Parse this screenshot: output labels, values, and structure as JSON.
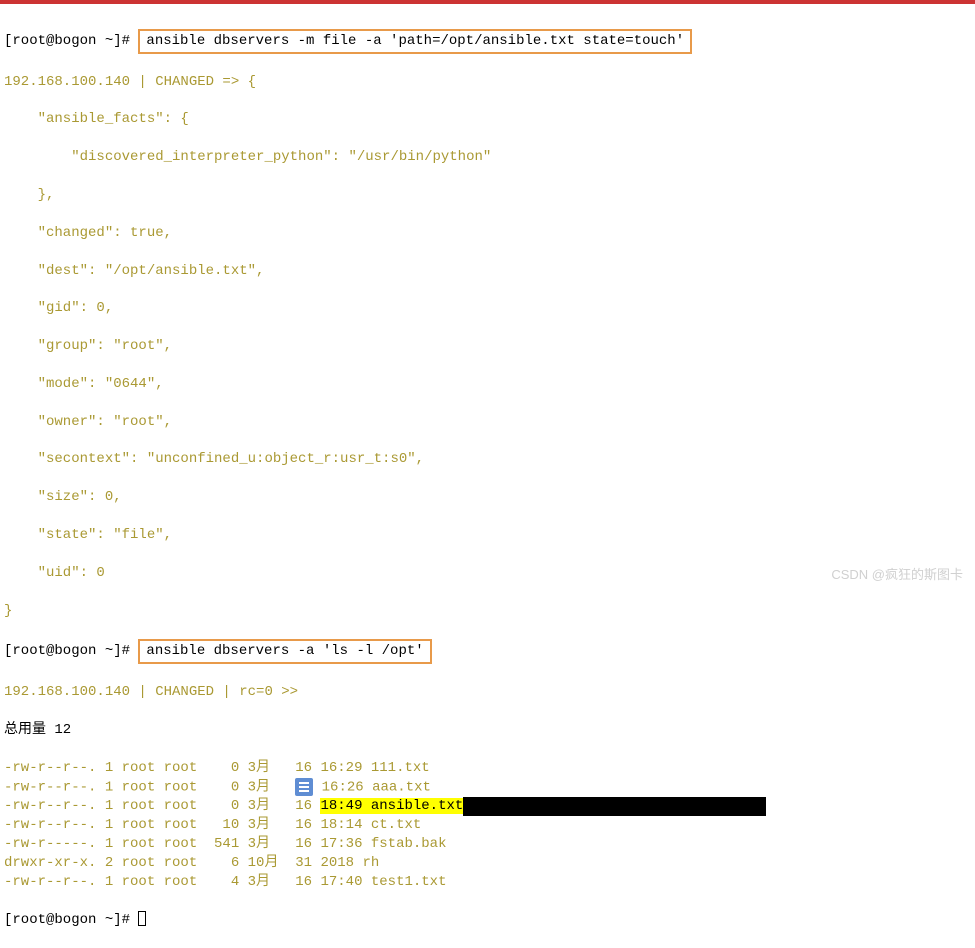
{
  "prompt1": {
    "user": "[root@bogon ~]# ",
    "cmd": "ansible dbservers -m file -a 'path=/opt/ansible.txt state=touch'"
  },
  "output1": {
    "line1": "192.168.100.140 | CHANGED => {",
    "line2": "    \"ansible_facts\": {",
    "line3": "        \"discovered_interpreter_python\": \"/usr/bin/python\"",
    "line4": "    },",
    "line5": "    \"changed\": true,",
    "line6": "    \"dest\": \"/opt/ansible.txt\",",
    "line7": "    \"gid\": 0,",
    "line8": "    \"group\": \"root\",",
    "line9": "    \"mode\": \"0644\",",
    "line10": "    \"owner\": \"root\",",
    "line11": "    \"secontext\": \"unconfined_u:object_r:usr_t:s0\",",
    "line12": "    \"size\": 0,",
    "line13": "    \"state\": \"file\",",
    "line14": "    \"uid\": 0",
    "line15": "}"
  },
  "prompt2": {
    "user": "[root@bogon ~]# ",
    "cmd": "ansible dbservers -a 'ls -l /opt'"
  },
  "output2": {
    "header": "192.168.100.140 | CHANGED | rc=0 >>",
    "total": "总用量 12",
    "files": [
      {
        "perm": "-rw-r--r--. 1 root root",
        "sz": "   0",
        "mon": "3月",
        "d": "16",
        "tm": "16:29",
        "n": "111.txt",
        "hl": false,
        "icon": false
      },
      {
        "perm": "-rw-r--r--. 1 root root",
        "sz": "   0",
        "mon": "3月",
        "d": "",
        "tm": "16:26",
        "n": "aaa.txt",
        "hl": false,
        "icon": true
      },
      {
        "perm": "-rw-r--r--. 1 root root",
        "sz": "   0",
        "mon": "3月",
        "d": "16",
        "tm": "18:49",
        "n": "ansible.txt",
        "hl": true,
        "icon": false
      },
      {
        "perm": "-rw-r--r--. 1 root root",
        "sz": "  10",
        "mon": "3月",
        "d": "16",
        "tm": "18:14",
        "n": "ct.txt",
        "hl": false,
        "icon": false
      },
      {
        "perm": "-rw-r-----. 1 root root",
        "sz": " 541",
        "mon": "3月",
        "d": "16",
        "tm": "17:36",
        "n": "fstab.bak",
        "hl": false,
        "icon": false
      },
      {
        "perm": "drwxr-xr-x. 2 root root",
        "sz": "   6",
        "mon": "10月",
        "d": "31",
        "tm": "2018",
        "n": "rh",
        "hl": false,
        "icon": false
      },
      {
        "perm": "-rw-r--r--. 1 root root",
        "sz": "   4",
        "mon": "3月",
        "d": "16",
        "tm": "17:40",
        "n": "test1.txt",
        "hl": false,
        "icon": false
      }
    ]
  },
  "prompt3": {
    "user": "[root@bogon ~]# "
  },
  "watermark": "CSDN @疯狂的斯图卡"
}
